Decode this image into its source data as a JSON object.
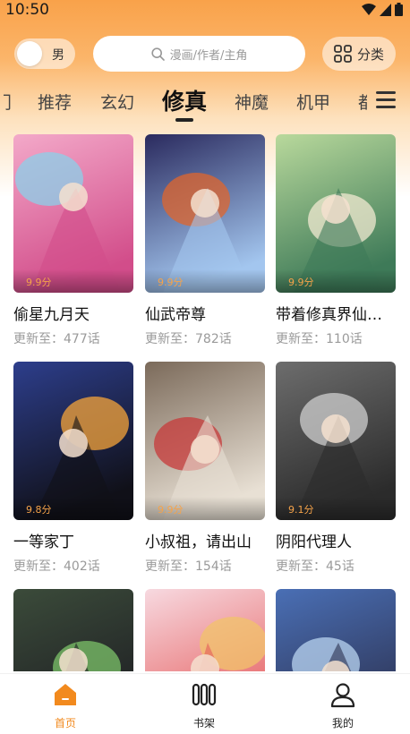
{
  "status_bar": {
    "time": "10:50"
  },
  "gender_toggle": {
    "label": "男"
  },
  "search": {
    "placeholder": "漫画/作者/主角"
  },
  "category": {
    "label": "分类"
  },
  "tabs": {
    "partial_left": "门",
    "items": [
      "推荐",
      "玄幻",
      "修真",
      "神魔",
      "机甲"
    ],
    "active": "修真",
    "partial_right": "都"
  },
  "comics": [
    {
      "title": "偷星九月天",
      "score": "9.9分",
      "update": "更新至：477话",
      "palette": [
        "#f3a9c9",
        "#8bd0ea",
        "#d24d8a"
      ]
    },
    {
      "title": "仙武帝尊",
      "score": "9.9分",
      "update": "更新至：782话",
      "palette": [
        "#2a2a5e",
        "#e0652c",
        "#a3c6ef"
      ]
    },
    {
      "title": "带着修真界仙子们天下无敌",
      "score": "9.9分",
      "update": "更新至：110话",
      "palette": [
        "#b9d99c",
        "#f2e9d2",
        "#3e7a58"
      ]
    },
    {
      "title": "一等家丁",
      "score": "9.8分",
      "update": "更新至：402话",
      "palette": [
        "#2d3e8c",
        "#f5a43a",
        "#101018"
      ]
    },
    {
      "title": "小叔祖，请出山",
      "score": "9.9分",
      "update": "更新至：154话",
      "palette": [
        "#7b6a5a",
        "#c73a3a",
        "#e8e0d4"
      ]
    },
    {
      "title": "阴阳代理人",
      "score": "9.1分",
      "update": "更新至：45话",
      "palette": [
        "#6d6d6d",
        "#cfcfcf",
        "#2b2b2b"
      ]
    },
    {
      "title": "",
      "score": "",
      "update": "",
      "palette": [
        "#3b4b3a",
        "#7cc36a",
        "#1d1d22"
      ]
    },
    {
      "title": "",
      "score": "",
      "update": "",
      "palette": [
        "#f7d9e0",
        "#f1c36a",
        "#e55b5b"
      ]
    },
    {
      "title": "",
      "score": "",
      "update": "",
      "palette": [
        "#4a6fb5",
        "#b9d4f0",
        "#2c3150"
      ]
    }
  ],
  "bottom_nav": {
    "items": [
      {
        "label": "首页",
        "icon": "home-icon",
        "active": true
      },
      {
        "label": "书架",
        "icon": "bookshelf-icon",
        "active": false
      },
      {
        "label": "我的",
        "icon": "profile-icon",
        "active": false
      }
    ],
    "accent": "#f28a1e"
  },
  "colors": {
    "header_top": "#f9a24a",
    "score": "#f5a34a"
  }
}
